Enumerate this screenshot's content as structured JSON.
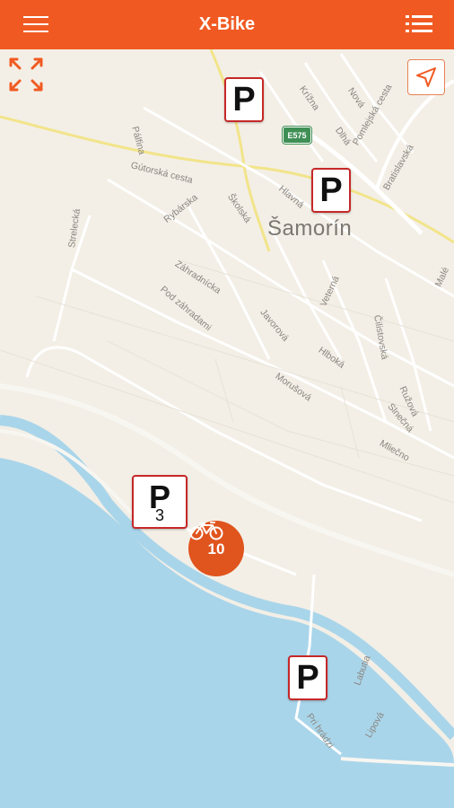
{
  "app": {
    "title": "X-Bike",
    "colors": {
      "accent": "#f05a22",
      "water": "#a9d5ea",
      "land": "#f3efe6",
      "parking_border": "#c62828",
      "bike_marker": "#e0541d"
    },
    "icons": {
      "menu": "hamburger-menu-icon",
      "list": "list-icon",
      "expand": "expand-arrows-icon",
      "locate": "navigation-arrow-icon",
      "bike": "bicycle-icon"
    }
  },
  "map": {
    "town_name": "Šamorín",
    "road_shield": "E575",
    "streets": [
      {
        "name": "Krížna"
      },
      {
        "name": "Nová"
      },
      {
        "name": "Dlhá"
      },
      {
        "name": "Pomlejská cesta"
      },
      {
        "name": "Bratislavská"
      },
      {
        "name": "Pálfina"
      },
      {
        "name": "Gútorská cesta"
      },
      {
        "name": "Hlavná"
      },
      {
        "name": "Školská"
      },
      {
        "name": "Rybárska"
      },
      {
        "name": "Strelecká"
      },
      {
        "name": "Záhradnícka"
      },
      {
        "name": "Pod záhradami"
      },
      {
        "name": "Javorová"
      },
      {
        "name": "Veterná"
      },
      {
        "name": "Čilistovská"
      },
      {
        "name": "Hlboká"
      },
      {
        "name": "Morušová"
      },
      {
        "name": "Ružová"
      },
      {
        "name": "Slnečná"
      },
      {
        "name": "Mliečno"
      },
      {
        "name": "Malé"
      },
      {
        "name": "Labutia"
      },
      {
        "name": "Pri hrádzi"
      },
      {
        "name": "Lipová"
      }
    ],
    "parking_markers": [
      {
        "label": "P",
        "count": ""
      },
      {
        "label": "P",
        "count": ""
      },
      {
        "label": "P",
        "count": "3"
      },
      {
        "label": "P",
        "count": ""
      }
    ],
    "bike_station": {
      "count": "10"
    }
  }
}
